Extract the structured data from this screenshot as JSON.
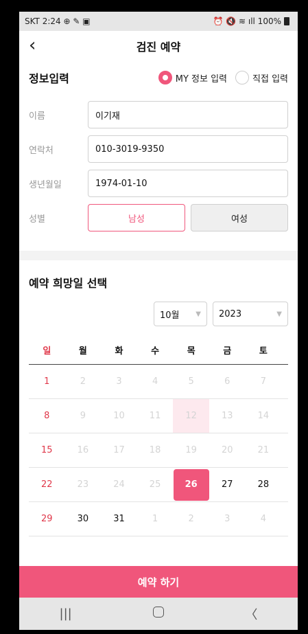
{
  "status": {
    "left": "SKT 2:24 ⊕ ✎ ▣",
    "right": "⏰ 🔇 ≋ ıll 100%"
  },
  "nav": {
    "title": "검진 예약"
  },
  "info": {
    "title": "정보입력",
    "radio_my": "MY 정보 입력",
    "radio_direct": "직접 입력",
    "name_label": "이름",
    "name_value": "이기재",
    "phone_label": "연락처",
    "phone_value": "010-3019-9350",
    "birth_label": "생년월일",
    "birth_value": "1974-01-10",
    "gender_label": "성별",
    "male": "남성",
    "female": "여성"
  },
  "reservation": {
    "title": "예약 희망일 선택",
    "month": "10월",
    "year": "2023",
    "weekdays": [
      "일",
      "월",
      "화",
      "수",
      "목",
      "금",
      "토"
    ],
    "weeks": [
      [
        "1",
        "2",
        "3",
        "4",
        "5",
        "6",
        "7"
      ],
      [
        "8",
        "9",
        "10",
        "11",
        "12",
        "13",
        "14"
      ],
      [
        "15",
        "16",
        "17",
        "18",
        "19",
        "20",
        "21"
      ],
      [
        "22",
        "23",
        "24",
        "25",
        "26",
        "27",
        "28"
      ],
      [
        "29",
        "30",
        "31",
        "1",
        "2",
        "3",
        "4"
      ]
    ],
    "selected_day": "26",
    "today_day": "12"
  },
  "cta": {
    "label": "예약 하기"
  },
  "sysnav": {
    "recent": "|||",
    "back": "〈"
  },
  "colors": {
    "accent": "#f0567b",
    "sunday": "#e0384a"
  }
}
